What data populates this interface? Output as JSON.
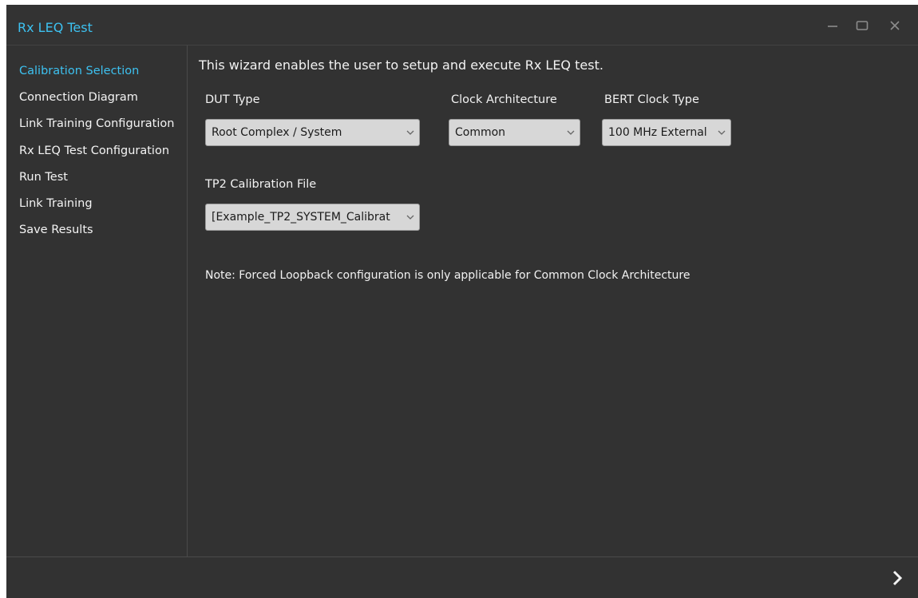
{
  "window": {
    "title": "Rx LEQ Test",
    "controls": {
      "minimize_icon": "minimize-icon",
      "maximize_icon": "maximize-icon",
      "close_icon": "close-icon"
    }
  },
  "sidebar": {
    "items": [
      {
        "label": "Calibration Selection",
        "active": true
      },
      {
        "label": "Connection Diagram",
        "active": false
      },
      {
        "label": "Link Training Configuration",
        "active": false
      },
      {
        "label": "Rx LEQ Test Configuration",
        "active": false
      },
      {
        "label": "Run Test",
        "active": false
      },
      {
        "label": "Link Training",
        "active": false
      },
      {
        "label": "Save Results",
        "active": false
      }
    ]
  },
  "main": {
    "intro": "This wizard enables the user to setup and execute Rx LEQ test.",
    "dut_type": {
      "label": "DUT Type",
      "value": "Root Complex / System"
    },
    "clock_architecture": {
      "label": "Clock Architecture",
      "value": "Common"
    },
    "bert_clock_type": {
      "label": "BERT Clock Type",
      "value": "100 MHz External"
    },
    "tp2_calibration_file": {
      "label": "TP2 Calibration File",
      "value": "[Example_TP2_SYSTEM_Calibrat"
    },
    "note": "Note: Forced Loopback configuration is only applicable for Common Clock Architecture"
  },
  "footer": {
    "next_icon": "chevron-right-icon"
  },
  "colors": {
    "accent": "#3dc1f0",
    "background": "#323232",
    "text": "#f2f2f2",
    "select_bg": "#d7d7d7"
  }
}
